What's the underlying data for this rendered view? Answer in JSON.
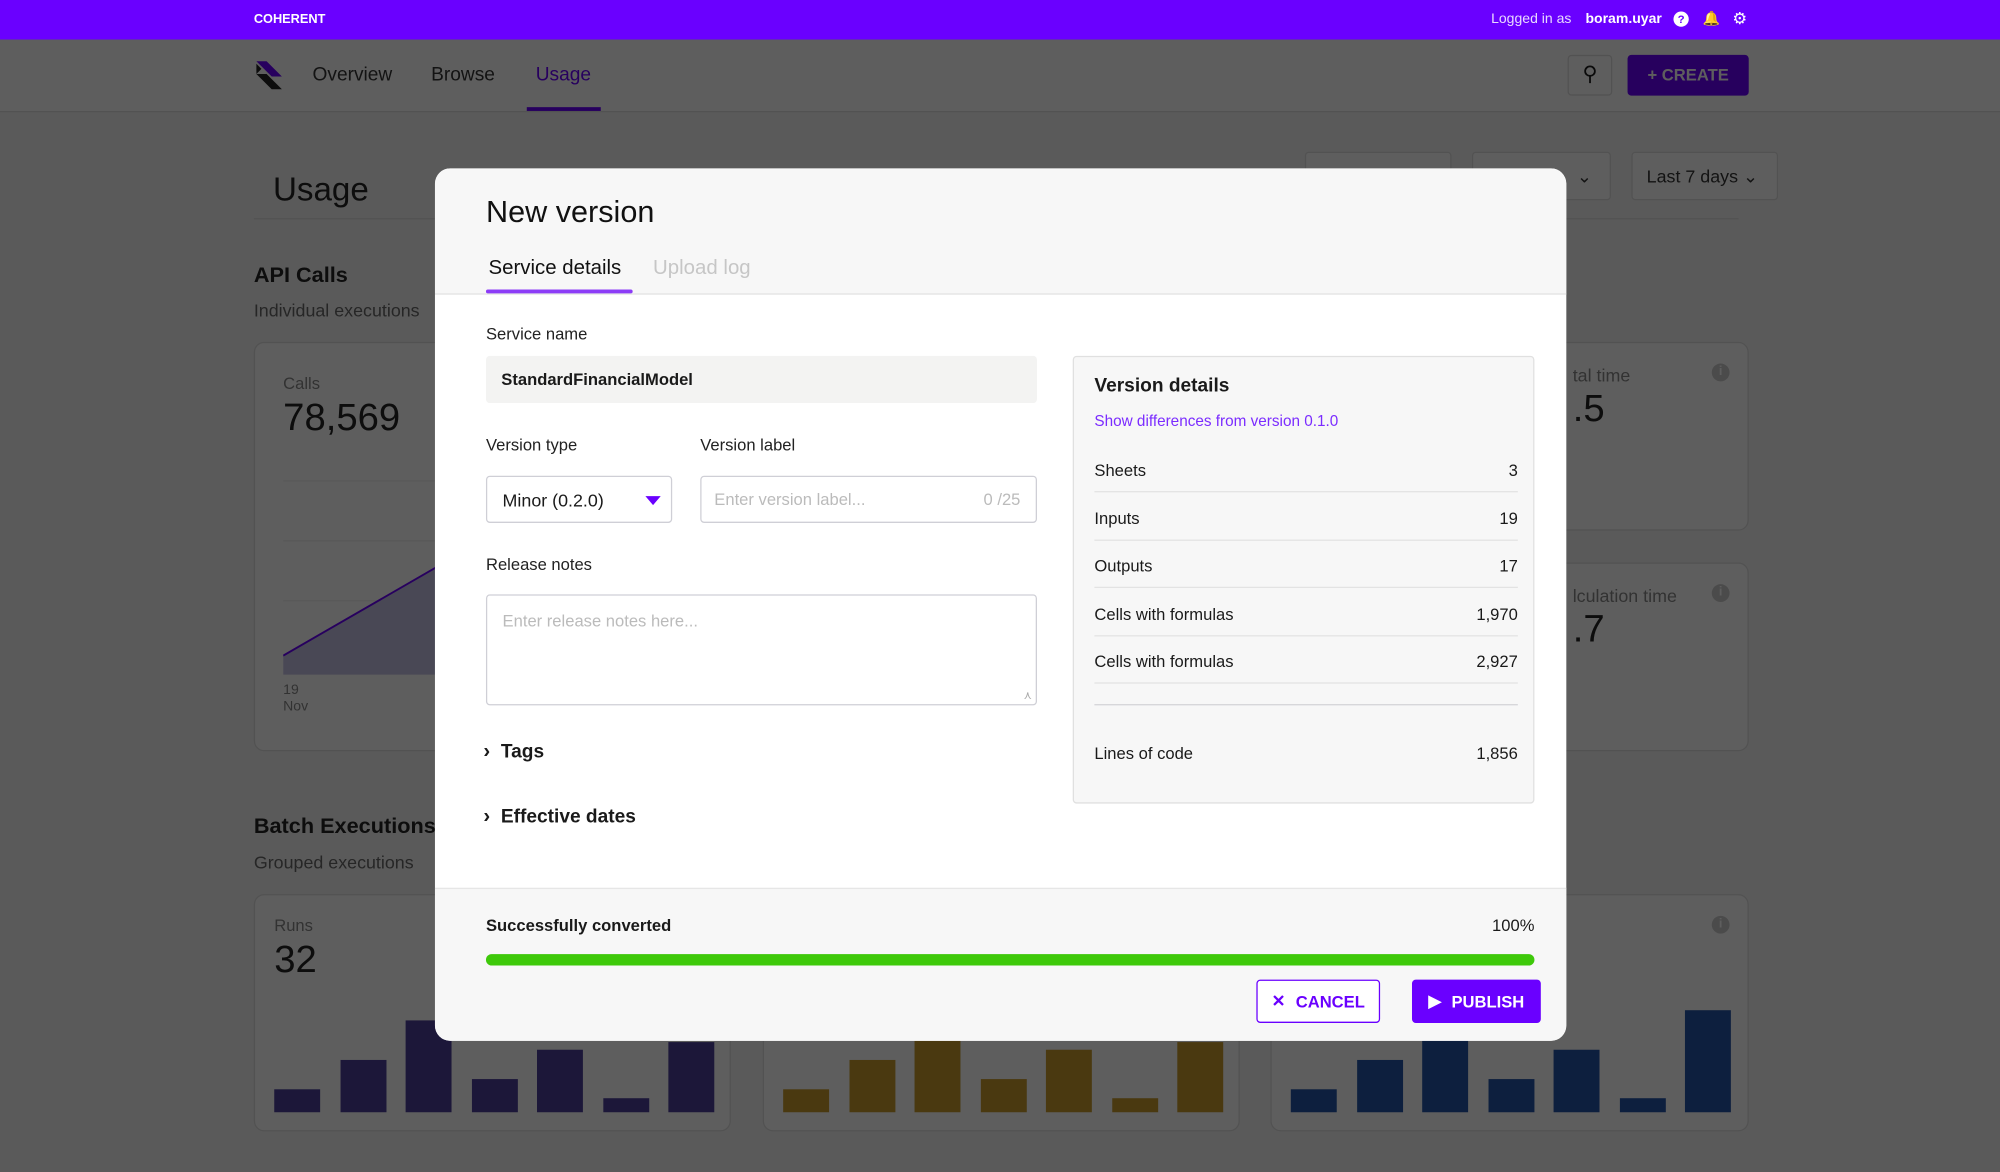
{
  "topbar": {
    "brand": "COHERENT",
    "logged_in_label": "Logged in as",
    "username": "boram.uyar",
    "icons": [
      "help-icon",
      "bell-icon",
      "gear-icon"
    ]
  },
  "nav": {
    "items": [
      "Overview",
      "Browse",
      "Usage"
    ],
    "active": "Usage",
    "create_label": "CREATE"
  },
  "page": {
    "title": "Usage",
    "filter_period": "Last 7 days",
    "api_calls": {
      "title": "API Calls",
      "subtitle": "Individual executions",
      "calls_label": "Calls",
      "calls_value": "78,569",
      "x_tick_day": "19",
      "x_tick_month": "Nov",
      "total_time_label": "tal time",
      "total_time_value": ".5",
      "calc_time_label": "lculation time",
      "calc_time_value": ".7"
    },
    "batch": {
      "title": "Batch Executions",
      "subtitle": "Grouped executions",
      "runs_label": "Runs",
      "runs_value": "32",
      "bars": [
        [
          18,
          41,
          72,
          26,
          49,
          11,
          55
        ],
        [
          18,
          41,
          72,
          26,
          49,
          11,
          55
        ],
        [
          18,
          41,
          72,
          26,
          49,
          11,
          80
        ]
      ],
      "bar_colors": [
        "#4b3f9a",
        "#c79a2c",
        "#2353a8"
      ]
    }
  },
  "modal": {
    "title": "New version",
    "tabs": [
      "Service details",
      "Upload log"
    ],
    "active_tab": "Service details",
    "service_name_label": "Service name",
    "service_name_value": "StandardFinancialModel",
    "version_type_label": "Version type",
    "version_type_value": "Minor (0.2.0)",
    "version_label_label": "Version label",
    "version_label_placeholder": "Enter version label...",
    "version_label_counter": "0 /25",
    "release_notes_label": "Release notes",
    "release_notes_placeholder": "Enter release notes here...",
    "tags_label": "Tags",
    "effective_dates_label": "Effective dates",
    "version_details": {
      "title": "Version details",
      "diff_link": "Show differences from version 0.1.0",
      "rows": [
        {
          "label": "Sheets",
          "value": "3"
        },
        {
          "label": "Inputs",
          "value": "19"
        },
        {
          "label": "Outputs",
          "value": "17"
        },
        {
          "label": "Cells with formulas",
          "value": "1,970"
        },
        {
          "label": "Cells with formulas",
          "value": "2,927"
        }
      ],
      "lines_of_code_label": "Lines of code",
      "lines_of_code_value": "1,856"
    },
    "status_text": "Successfully converted",
    "progress_text": "100%",
    "progress": 100,
    "progress_color": "#3ec90a",
    "cancel_label": "CANCEL",
    "publish_label": "PUBLISH",
    "accent": "#6a00ff"
  }
}
